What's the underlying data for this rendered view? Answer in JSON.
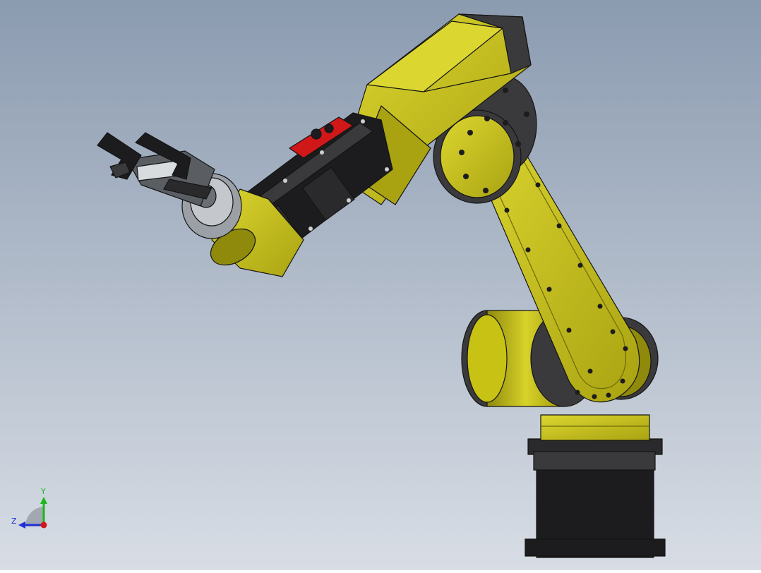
{
  "viewport": {
    "background_top": "#8b9bb0",
    "background_bottom": "#d8dde5"
  },
  "model": {
    "colors": {
      "body_yellow": "#c8c214",
      "body_yellow_light": "#dcd630",
      "body_yellow_dark": "#8f8a0c",
      "dark_gray": "#3a3a3c",
      "black": "#1c1c1e",
      "accent_red": "#d01818",
      "metal": "#9aa0a6"
    }
  },
  "triad": {
    "y_label": "Y",
    "z_label": "Z",
    "y_color": "#1bb81b",
    "z_color": "#2030d8",
    "x_color": "#d01818"
  }
}
